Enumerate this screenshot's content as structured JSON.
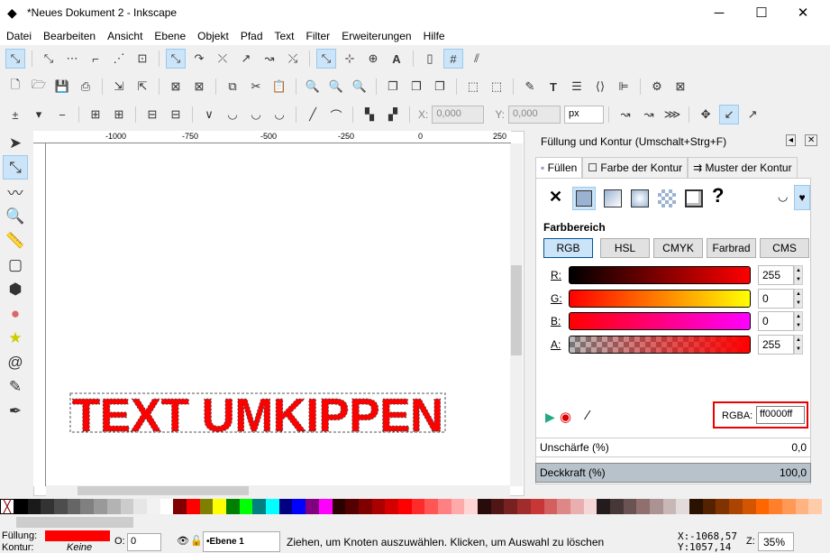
{
  "window": {
    "title": "*Neues Dokument 2 - Inkscape",
    "minimize": "─",
    "maximize": "☐",
    "close": "✕"
  },
  "menu": [
    "Datei",
    "Bearbeiten",
    "Ansicht",
    "Ebene",
    "Objekt",
    "Pfad",
    "Text",
    "Filter",
    "Erweiterungen",
    "Hilfe"
  ],
  "node_toolbar": {
    "x_label": "X:",
    "x_value": "0,000",
    "y_label": "Y:",
    "y_value": "0,000",
    "unit": "px"
  },
  "ruler": {
    "ticks": [
      "-1000",
      "-750",
      "-500",
      "-250",
      "0",
      "250"
    ]
  },
  "canvas": {
    "text": "TEXT UMKIPPEN"
  },
  "panel": {
    "title": "Füllung und Kontur (Umschalt+Strg+F)",
    "tabs": [
      "Füllen",
      "Farbe der Kontur",
      "Muster der Kontur"
    ],
    "section": "Farbbereich",
    "modes": [
      "RGB",
      "HSL",
      "CMYK",
      "Farbrad",
      "CMS"
    ],
    "channels": [
      {
        "label": "R:",
        "value": "255"
      },
      {
        "label": "G:",
        "value": "0"
      },
      {
        "label": "B:",
        "value": "0"
      },
      {
        "label": "A:",
        "value": "255"
      }
    ],
    "rgba_label": "RGBA:",
    "rgba_value": "ff0000ff",
    "blur_label": "Unschärfe (%)",
    "blur_value": "0,0",
    "opacity_label": "Deckkraft (%)",
    "opacity_value": "100,0",
    "unknown": "?"
  },
  "palette": [
    "#000000",
    "#1a1a1a",
    "#333333",
    "#4d4d4d",
    "#666666",
    "#808080",
    "#999999",
    "#b3b3b3",
    "#cccccc",
    "#e6e6e6",
    "#f2f2f2",
    "#ffffff",
    "#800000",
    "#ff0000",
    "#808000",
    "#ffff00",
    "#008000",
    "#00ff00",
    "#008080",
    "#00ffff",
    "#000080",
    "#0000ff",
    "#800080",
    "#ff00ff",
    "#2b0000",
    "#550000",
    "#800000",
    "#aa0000",
    "#d40000",
    "#ff0000",
    "#ff2a2a",
    "#ff5555",
    "#ff8080",
    "#ffaaaa",
    "#ffd5d5",
    "#280b0b",
    "#501616",
    "#782121",
    "#a02c2c",
    "#c83737",
    "#d35f5f",
    "#de8787",
    "#e9afaf",
    "#f4d7d7",
    "#241c1c",
    "#483737",
    "#6c5353",
    "#916f6f",
    "#ac9393",
    "#c8b7b7",
    "#e3dbdb",
    "#2b1100",
    "#552200",
    "#803300",
    "#aa4400",
    "#d45500",
    "#ff6600",
    "#ff7f2a",
    "#ff9955",
    "#ffb380",
    "#ffccaa"
  ],
  "status": {
    "fill_label": "Füllung:",
    "stroke_label": "Kontur:",
    "stroke_value": "Keine",
    "fill_color": "#ff0000",
    "opacity_label": "O:",
    "opacity_value": "0",
    "layer": "•Ebene 1",
    "message": "Ziehen, um Knoten auszuwählen. Klicken, um Auswahl zu löschen",
    "x_label": "X:",
    "x_value": "-1068,57",
    "y_label": "Y:",
    "y_value": "1057,14",
    "zoom_label": "Z:",
    "zoom_value": "35%"
  }
}
